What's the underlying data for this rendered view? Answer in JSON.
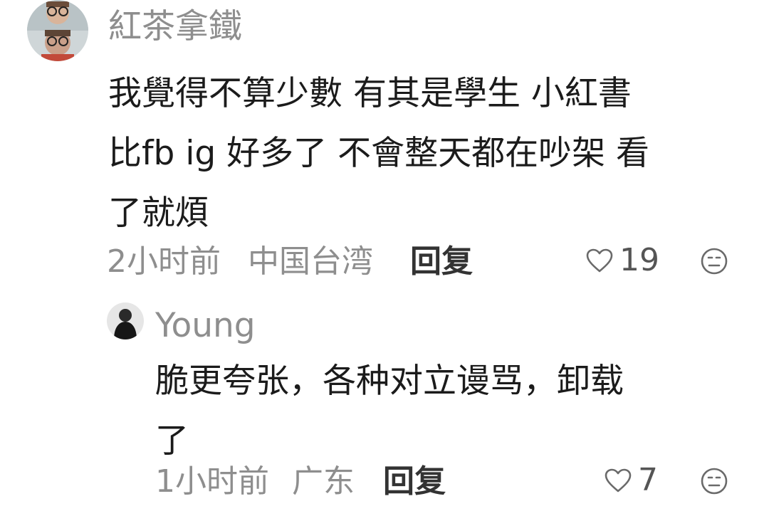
{
  "colors": {
    "meta_gray": "#8e8e8e",
    "text_dark": "#1b1b1b",
    "reply_dark": "#333333"
  },
  "comment": {
    "username": "紅茶拿鐵",
    "lines": [
      "我覺得不算少數 有其是學生 小紅書",
      "比fb ig 好多了 不會整天都在吵架 看",
      "了就煩"
    ],
    "time": "2小时前",
    "location": "中国台湾",
    "reply_label": "回复",
    "like_count": "19",
    "like_icon": "heart-outline-icon",
    "dislike_icon": "neutral-face-icon"
  },
  "reply": {
    "username": "Young",
    "lines": [
      "脆更夸张，各种对立谩骂，卸载",
      "了"
    ],
    "time": "1小时前",
    "location": "广东",
    "reply_label": "回复",
    "like_count": "7",
    "like_icon": "heart-outline-icon",
    "dislike_icon": "neutral-face-icon"
  }
}
